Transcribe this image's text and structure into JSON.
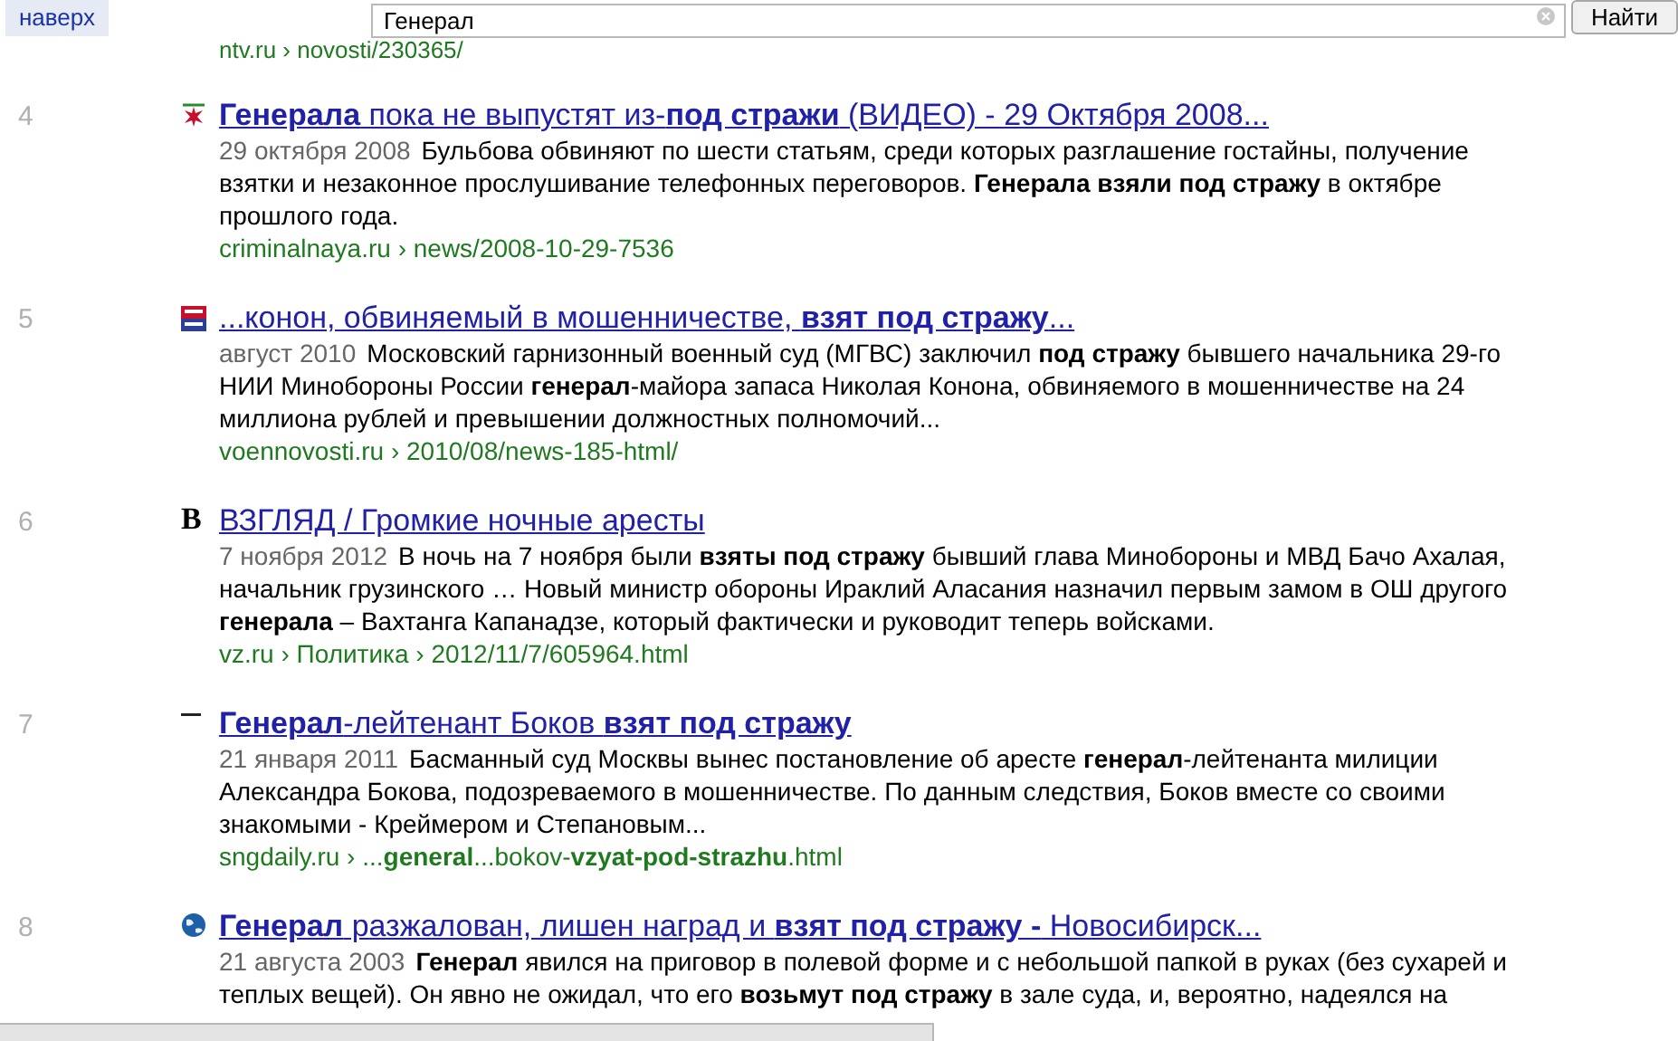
{
  "header": {
    "top_button": "наверх",
    "search": {
      "value": "Генерал"
    },
    "search_button": "Найти"
  },
  "prev_url": "ntv.ru › novosti/230365/",
  "results": [
    {
      "number": "4",
      "icon": {
        "kind": "star"
      },
      "title": "**Генерала** пока не выпустят из-**под стражи** (ВИДЕО) - 29 Октября 2008...",
      "date": "29 октября 2008",
      "snippet": "Бульбова обвиняют по шести статьям, среди которых разглашение гостайны, получение взятки и незаконное прослушивание телефонных переговоров. **Генерала взяли под стражу** в октябре прошлого года.",
      "url": "criminalnaya.ru › news/2008-10-29-7536"
    },
    {
      "number": "5",
      "icon": {
        "kind": "news"
      },
      "title": "...конон, обвиняемый в мошенничестве, **взят под стражу**...",
      "date": "август 2010",
      "snippet": "Московский гарнизонный военный суд (МГВС) заключил **под стражу** бывшего начальника 29-го НИИ Минобороны России **генерал**-майора запаса Николая Конона, обвиняемого в мошенничестве на 24 миллиона рублей и превышении должностных полномочий...",
      "url": "voennovosti.ru › 2010/08/news-185-html/"
    },
    {
      "number": "6",
      "icon": {
        "kind": "letter",
        "text": "B"
      },
      "title": "ВЗГЛЯД / Громкие ночные аресты",
      "date": "7 ноября 2012",
      "snippet": "В ночь на 7 ноября были **взяты под стражу** бывший глава Минобороны и МВД Бачо Ахалая, начальник грузинского … Новый министр обороны Ираклий Аласания назначил первым замом в ОШ другого **генерала** – Вахтанга Капанадзе, который фактически и руководит теперь войсками.",
      "url": "vz.ru › Политика › 2012/11/7/605964.html"
    },
    {
      "number": "7",
      "icon": {
        "kind": "dash"
      },
      "title": "**Генерал**-лейтенант Боков **взят под стражу**",
      "date": "21 января 2011",
      "snippet": "Басманный суд Москвы вынес постановление об аресте **генерал**-лейтенанта милиции Александра Бокова, подозреваемого в мошенничестве. По данным следствия, Боков вместе со своими знакомыми - Креймером и Степановым...",
      "url": "sngdaily.ru › ...**general**...bokov-**vzyat-pod-strazhu**.html"
    },
    {
      "number": "8",
      "icon": {
        "kind": "globe"
      },
      "title": "**Генерал** разжалован, лишен наград и **взят под стражу -** Новосибирск...",
      "date": "21 августа 2003",
      "snippet": "**Генерал** явился на приговор в полевой форме и с небольшой папкой в руках (без сухарей и теплых вещей). Он явно не ожидал, что его **возьмут под стражу** в зале суда, и, вероятно, надеялся на"
    }
  ]
}
